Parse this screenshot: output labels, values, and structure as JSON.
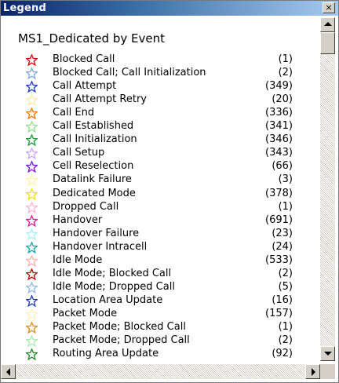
{
  "window": {
    "title": "Legend",
    "close_label": "×"
  },
  "legend": {
    "heading": "MS1_Dedicated by Event",
    "items": [
      {
        "label": "Blocked Call",
        "count": "(1)",
        "color": "#e00000"
      },
      {
        "label": "Blocked Call; Call Initialization",
        "count": "(2)",
        "color": "#7da7e0"
      },
      {
        "label": "Call Attempt",
        "count": "(349)",
        "color": "#1a3fbf"
      },
      {
        "label": "Call Attempt Retry",
        "count": "(20)",
        "color": "#ffe9a8"
      },
      {
        "label": "Call End",
        "count": "(336)",
        "color": "#f07c00"
      },
      {
        "label": "Call Established",
        "count": "(341)",
        "color": "#8fe08f"
      },
      {
        "label": "Call Initialization",
        "count": "(346)",
        "color": "#1a9a3a"
      },
      {
        "label": "Call Setup",
        "count": "(343)",
        "color": "#c9a6ff"
      },
      {
        "label": "Cell Reselection",
        "count": "(66)",
        "color": "#7a18d8"
      },
      {
        "label": "Datalink Failure",
        "count": "(3)",
        "color": "#fff2a0"
      },
      {
        "label": "Dedicated Mode",
        "count": "(378)",
        "color": "#f2e000"
      },
      {
        "label": "Dropped Call",
        "count": "(1)",
        "color": "#ffb0d8"
      },
      {
        "label": "Handover",
        "count": "(691)",
        "color": "#e0159e"
      },
      {
        "label": "Handover Failure",
        "count": "(23)",
        "color": "#a8f0f8"
      },
      {
        "label": "Handover Intracell",
        "count": "(24)",
        "color": "#10a8b0"
      },
      {
        "label": "Idle Mode",
        "count": "(533)",
        "color": "#ffb0b0"
      },
      {
        "label": "Idle Mode; Blocked Call",
        "count": "(2)",
        "color": "#b80000"
      },
      {
        "label": "Idle Mode; Dropped Call",
        "count": "(5)",
        "color": "#90b8f0"
      },
      {
        "label": "Location Area Update",
        "count": "(16)",
        "color": "#1c3aa8"
      },
      {
        "label": "Packet Mode",
        "count": "(157)",
        "color": "#ffeec0"
      },
      {
        "label": "Packet Mode; Blocked Call",
        "count": "(1)",
        "color": "#f08a10"
      },
      {
        "label": "Packet Mode; Dropped Call",
        "count": "(2)",
        "color": "#a8eba8"
      },
      {
        "label": "Routing Area Update",
        "count": "(92)",
        "color": "#1a8a2a"
      }
    ]
  },
  "scroll": {
    "vertical_position": 0.0,
    "horizontal_position": 0.0
  }
}
